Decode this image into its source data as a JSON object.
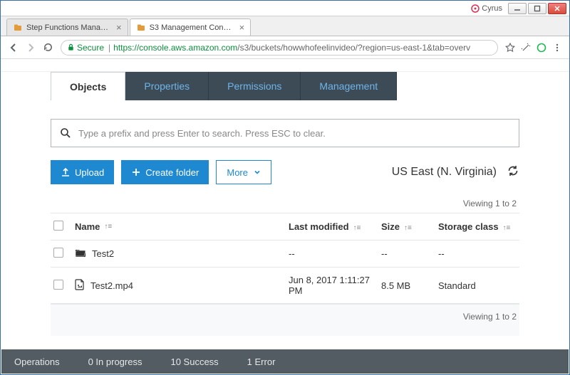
{
  "window": {
    "user_label": "Cyrus"
  },
  "browser": {
    "tabs": [
      {
        "title": "Step Functions Managem",
        "active": false
      },
      {
        "title": "S3 Management Console",
        "active": true
      }
    ],
    "secure_label": "Secure",
    "url_host": "https://console.aws.amazon.com",
    "url_rest": "/s3/buckets/howwhofeelinvideo/?region=us-east-1&tab=overv"
  },
  "nav_tabs": {
    "items": [
      "Objects",
      "Properties",
      "Permissions",
      "Management"
    ],
    "active": "Objects"
  },
  "search": {
    "placeholder": "Type a prefix and press Enter to search. Press ESC to clear."
  },
  "toolbar": {
    "upload_label": "Upload",
    "create_folder_label": "Create folder",
    "more_label": "More",
    "region_label": "US East (N. Virginia)"
  },
  "table": {
    "viewing_label": "Viewing 1 to 2",
    "headers": {
      "name": "Name",
      "modified": "Last modified",
      "size": "Size",
      "class": "Storage class"
    },
    "rows": [
      {
        "type": "folder",
        "name": "Test2",
        "modified": "--",
        "size": "--",
        "class": "--"
      },
      {
        "type": "file",
        "name": "Test2.mp4",
        "modified": "Jun 8, 2017 1:11:27 PM",
        "size": "8.5 MB",
        "class": "Standard"
      }
    ]
  },
  "status": {
    "operations": "Operations",
    "in_progress": "0 In progress",
    "success": "10 Success",
    "error": "1 Error"
  }
}
